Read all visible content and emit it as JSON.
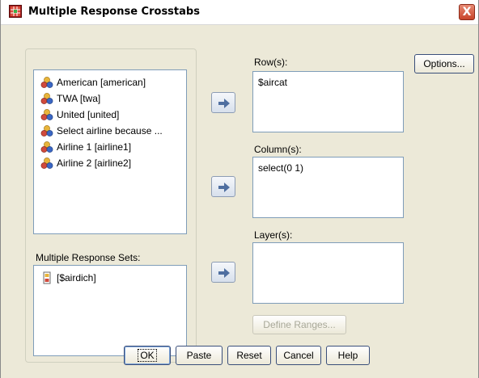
{
  "window": {
    "title": "Multiple Response Crosstabs",
    "close_label": "X"
  },
  "variables": {
    "items": [
      {
        "label": "American [american]",
        "icon": "nominal-variable-icon"
      },
      {
        "label": "TWA [twa]",
        "icon": "nominal-variable-icon"
      },
      {
        "label": "United [united]",
        "icon": "nominal-variable-icon"
      },
      {
        "label": "Select airline because ...",
        "icon": "nominal-variable-icon"
      },
      {
        "label": "Airline 1 [airline1]",
        "icon": "nominal-variable-icon"
      },
      {
        "label": "Airline 2 [airline2]",
        "icon": "nominal-variable-icon"
      }
    ]
  },
  "mr_sets": {
    "label": "Multiple Response Sets:",
    "items": [
      {
        "label": "[$airdich]",
        "icon": "multiple-response-set-icon"
      }
    ]
  },
  "targets": {
    "rows": {
      "label": "Row(s):",
      "items": [
        "$aircat"
      ]
    },
    "columns": {
      "label": "Column(s):",
      "items": [
        "select(0 1)"
      ]
    },
    "layers": {
      "label": "Layer(s):",
      "items": []
    }
  },
  "buttons": {
    "options": "Options...",
    "define_ranges": "Define Ranges...",
    "ok": "OK",
    "paste": "Paste",
    "reset": "Reset",
    "cancel": "Cancel",
    "help": "Help"
  },
  "colors": {
    "dialog_bg": "#ece9d8",
    "list_border": "#7f9db9",
    "close_button": "#c8442a"
  }
}
